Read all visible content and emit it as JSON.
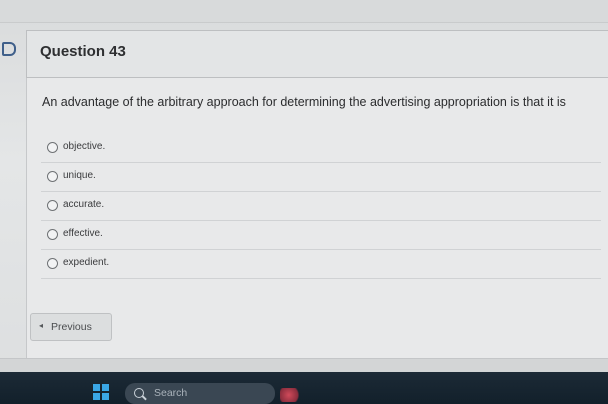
{
  "question": {
    "title": "Question 43",
    "text": "An advantage of the arbitrary approach for determining the advertising appropriation is that it is",
    "choices": [
      {
        "label": "objective."
      },
      {
        "label": "unique."
      },
      {
        "label": "accurate."
      },
      {
        "label": "effective."
      },
      {
        "label": "expedient."
      }
    ]
  },
  "navigation": {
    "previous_label": "Previous",
    "previous_arrow": "◂"
  },
  "taskbar": {
    "search_label": "Search"
  },
  "colors": {
    "taskbar": "#12202b",
    "windows_logo": "#3aa7e6",
    "bookmark": "#3f5f8a"
  }
}
